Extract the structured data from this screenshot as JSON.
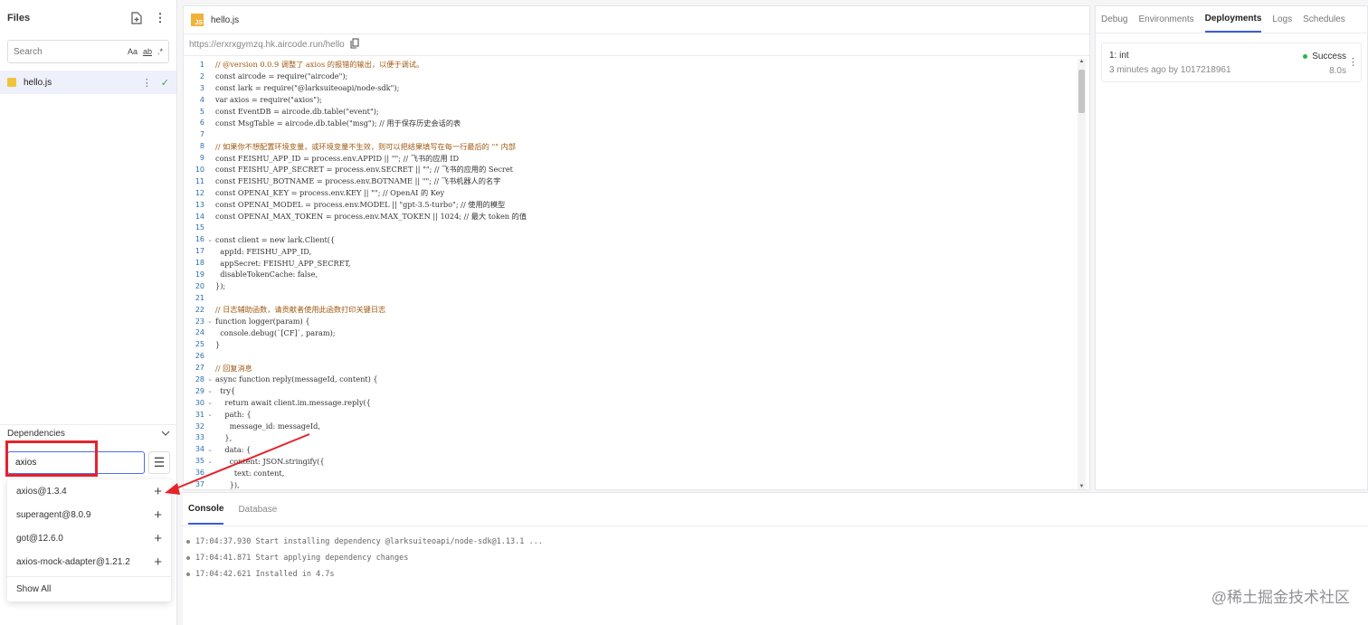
{
  "files_panel": {
    "title": "Files",
    "search_placeholder": "Search",
    "search_opt_case": "Aa",
    "search_opt_word": "ab",
    "search_opt_regex": ".*",
    "file": {
      "name": "hello.js",
      "status_icon": "check-icon"
    }
  },
  "dependencies": {
    "title": "Dependencies",
    "input_value": "axios",
    "results": [
      {
        "label": "axios@1.3.4"
      },
      {
        "label": "superagent@8.0.9"
      },
      {
        "label": "got@12.6.0"
      },
      {
        "label": "axios-mock-adapter@1.21.2"
      }
    ],
    "show_all": "Show All"
  },
  "editor": {
    "tab_title": "hello.js",
    "js_icon_text": "JS",
    "url": "https://erxrxgymzq.hk.aircode.run/hello",
    "lines": [
      {
        "n": "1",
        "fold": "",
        "text": "// @version 0.0.9 调整了 axios 的报错的输出，以便于调试。",
        "cls": "cm"
      },
      {
        "n": "2",
        "fold": "",
        "text": "const aircode = require(\"aircode\");",
        "cls": "src"
      },
      {
        "n": "3",
        "fold": "",
        "text": "const lark = require(\"@larksuiteoapi/node-sdk\");",
        "cls": "src"
      },
      {
        "n": "4",
        "fold": "",
        "text": "var axios = require(\"axios\");",
        "cls": "src"
      },
      {
        "n": "5",
        "fold": "",
        "text": "const EventDB = aircode.db.table(\"event\");",
        "cls": "src"
      },
      {
        "n": "6",
        "fold": "",
        "text": "const MsgTable = aircode.db.table(\"msg\"); // 用于保存历史会话的表",
        "cls": "src"
      },
      {
        "n": "7",
        "fold": "",
        "text": "",
        "cls": "src"
      },
      {
        "n": "8",
        "fold": "",
        "text": "// 如果你不想配置环境变量，或环境变量不生效，则可以把结果填写在每一行最后的 \"\" 内部",
        "cls": "cm"
      },
      {
        "n": "9",
        "fold": "",
        "text": "const FEISHU_APP_ID = process.env.APPID || \"\"; // 飞书的应用 ID",
        "cls": "src"
      },
      {
        "n": "10",
        "fold": "",
        "text": "const FEISHU_APP_SECRET = process.env.SECRET || \"\"; // 飞书的应用的 Secret",
        "cls": "src"
      },
      {
        "n": "11",
        "fold": "",
        "text": "const FEISHU_BOTNAME = process.env.BOTNAME || \"\"; // 飞书机器人的名字",
        "cls": "src"
      },
      {
        "n": "12",
        "fold": "",
        "text": "const OPENAI_KEY = process.env.KEY || \"\"; // OpenAI 的 Key",
        "cls": "src"
      },
      {
        "n": "13",
        "fold": "",
        "text": "const OPENAI_MODEL = process.env.MODEL || \"gpt-3.5-turbo\"; // 使用的模型",
        "cls": "src"
      },
      {
        "n": "14",
        "fold": "",
        "text": "const OPENAI_MAX_TOKEN = process.env.MAX_TOKEN || 1024; // 最大 token 的值",
        "cls": "src"
      },
      {
        "n": "15",
        "fold": "",
        "text": "",
        "cls": "src"
      },
      {
        "n": "16",
        "fold": "⌄",
        "text": "const client = new lark.Client({",
        "cls": "src"
      },
      {
        "n": "17",
        "fold": "",
        "text": "  appId: FEISHU_APP_ID,",
        "cls": "src"
      },
      {
        "n": "18",
        "fold": "",
        "text": "  appSecret: FEISHU_APP_SECRET,",
        "cls": "src"
      },
      {
        "n": "19",
        "fold": "",
        "text": "  disableTokenCache: false,",
        "cls": "src"
      },
      {
        "n": "20",
        "fold": "",
        "text": "});",
        "cls": "src"
      },
      {
        "n": "21",
        "fold": "",
        "text": "",
        "cls": "src"
      },
      {
        "n": "22",
        "fold": "",
        "text": "// 日志辅助函数，请贡献者使用此函数打印关键日志",
        "cls": "cm"
      },
      {
        "n": "23",
        "fold": "⌄",
        "text": "function logger(param) {",
        "cls": "src"
      },
      {
        "n": "24",
        "fold": "",
        "text": "  console.debug(`[CF]`, param);",
        "cls": "src"
      },
      {
        "n": "25",
        "fold": "",
        "text": "}",
        "cls": "src"
      },
      {
        "n": "26",
        "fold": "",
        "text": "",
        "cls": "src"
      },
      {
        "n": "27",
        "fold": "",
        "text": "// 回复消息",
        "cls": "cm"
      },
      {
        "n": "28",
        "fold": "⌄",
        "text": "async function reply(messageId, content) {",
        "cls": "src"
      },
      {
        "n": "29",
        "fold": "⌄",
        "text": "  try{",
        "cls": "src"
      },
      {
        "n": "30",
        "fold": "⌄",
        "text": "    return await client.im.message.reply({",
        "cls": "src"
      },
      {
        "n": "31",
        "fold": "⌄",
        "text": "    path: {",
        "cls": "src"
      },
      {
        "n": "32",
        "fold": "",
        "text": "      message_id: messageId,",
        "cls": "src"
      },
      {
        "n": "33",
        "fold": "",
        "text": "    },",
        "cls": "src"
      },
      {
        "n": "34",
        "fold": "⌄",
        "text": "    data: {",
        "cls": "src"
      },
      {
        "n": "35",
        "fold": "⌄",
        "text": "      content: JSON.stringify({",
        "cls": "src"
      },
      {
        "n": "36",
        "fold": "",
        "text": "        text: content,",
        "cls": "src"
      },
      {
        "n": "37",
        "fold": "",
        "text": "      }),",
        "cls": "src"
      }
    ]
  },
  "right_panel": {
    "tabs": [
      {
        "label": "Debug",
        "active": false
      },
      {
        "label": "Environments",
        "active": false
      },
      {
        "label": "Deployments",
        "active": true
      },
      {
        "label": "Logs",
        "active": false
      },
      {
        "label": "Schedules",
        "active": false
      }
    ],
    "deployment": {
      "name": "1: int",
      "meta": "3 minutes ago by 1017218961",
      "status": "Success",
      "duration": "8.0s",
      "status_color": "#2fb344"
    }
  },
  "console": {
    "tabs": [
      {
        "label": "Console",
        "active": true
      },
      {
        "label": "Database",
        "active": false
      }
    ],
    "logs": [
      {
        "text": "17:04:37.930 Start installing dependency @larksuiteoapi/node-sdk@1.13.1 ..."
      },
      {
        "text": "17:04:41.871 Start applying dependency changes"
      },
      {
        "text": "17:04:42.621 Installed in 4.7s"
      }
    ]
  },
  "watermark": "@稀土掘金技术社区",
  "colors": {
    "accent": "#3b5bdb",
    "annotation": "#e3242b",
    "success": "#2fb344"
  }
}
